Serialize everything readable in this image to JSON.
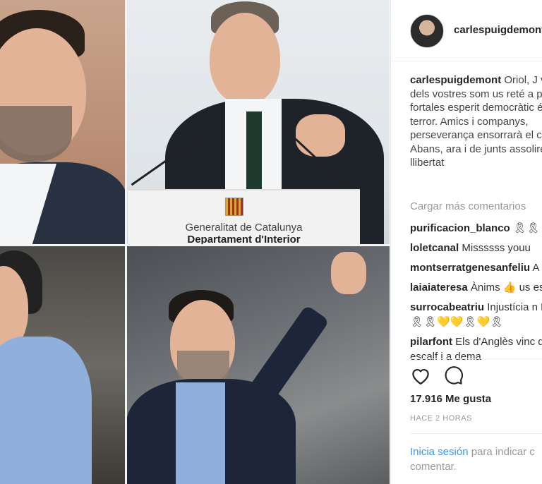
{
  "collage": {
    "podium_line1": "Generalitat de Catalunya",
    "podium_line2": "Departament d'Interior"
  },
  "post": {
    "header_username": "carlespuigdemont",
    "caption_username": "carlespuigdemont",
    "caption_text": "Oriol, J violència dels vostres som us reté a presó. La fortales esperit democràtic és el q terror. Amics i companys, perseverança ensorrarà el corrumpt. Abans, ara i de junts assolirem la llibertat",
    "load_more": "Cargar más comentarios",
    "comments": [
      {
        "user": "purificacion_blanco",
        "text": "🎗🎗"
      },
      {
        "user": "loletcanal",
        "text": "Missssss youu"
      },
      {
        "user": "montserratgenesanfeliu",
        "text": "A"
      },
      {
        "user": "laiaiateresa",
        "text": "Ànims 👍 us es"
      },
      {
        "user": "surrocabeatriu",
        "text": "Injustícia n República 🎗🎗💛💛🎗💛🎗"
      },
      {
        "user": "pilarfont",
        "text": "Els d'Anglès vinc donar vos escalf i a dema"
      }
    ],
    "likes": "17.916 Me gusta",
    "time": "HACE 2 HORAS",
    "login_link": "Inicia sesión",
    "login_text": "para indicar c comentar."
  },
  "icons": [
    "heart-icon",
    "comment-icon"
  ]
}
